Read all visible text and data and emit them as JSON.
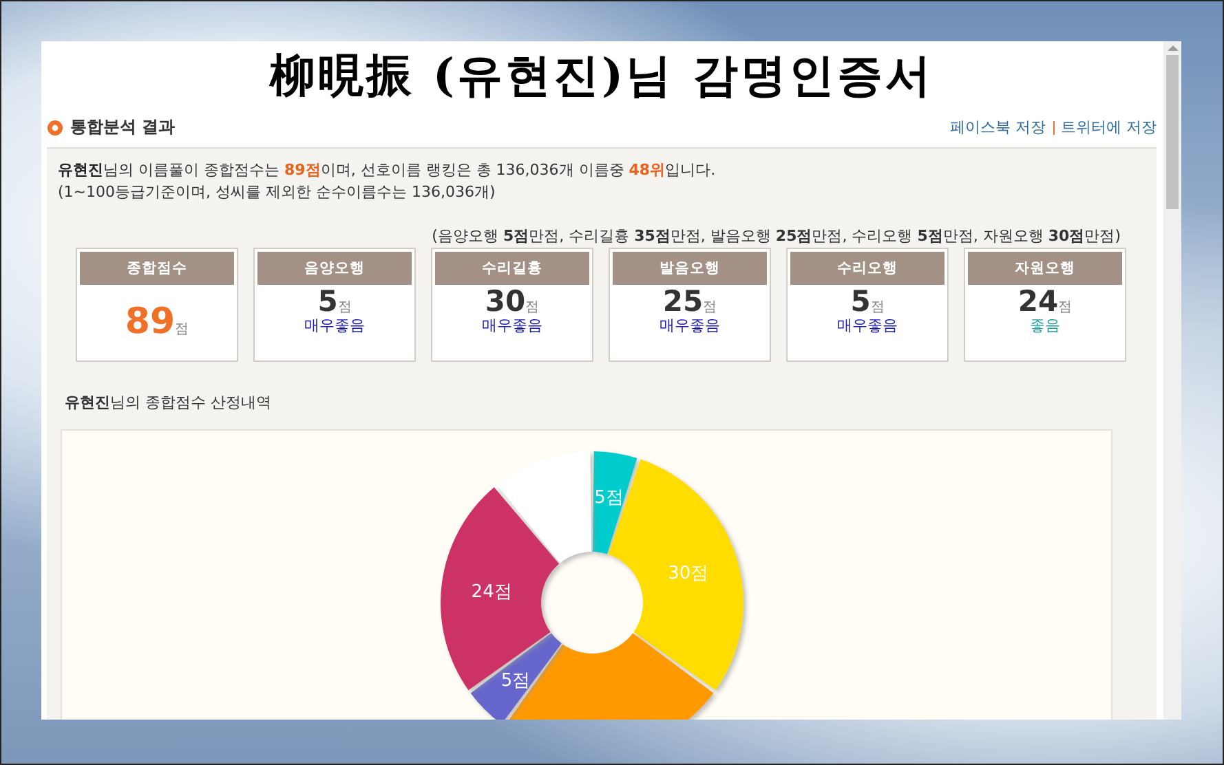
{
  "certificate_title": "柳晛振 (유현진)님 감명인증서",
  "section": {
    "title": "통합분석 결과",
    "links": [
      "페이스북 저장",
      "트위터에 저장"
    ]
  },
  "summary": {
    "lines": [
      "**유현진**님의 이름풀이 종합점수는 **89점**이며, 선호이름 랭킹은 총 136,036개 이름중 **48위**입니다.",
      "(1~100등급기준이며, 성씨를 제외한 순수이름수는 136,036개)"
    ]
  },
  "max_scores_note": "(음양오행 **5점**만점, 수리길흉 **35점**만점, 발음오행 **25점**만점, 수리오행 **5점**만점, 자원오행 **30점**만점)",
  "score_cards": [
    {
      "kind": "total",
      "label": "종합점수",
      "score": "89",
      "unit": "점"
    },
    {
      "kind": "element",
      "label": "음양오행",
      "score": "5",
      "unit": "점",
      "grade": "매우좋음",
      "color": "#1a1ab0"
    },
    {
      "kind": "element",
      "label": "수리길흉",
      "score": "30",
      "unit": "점",
      "grade": "매우좋음",
      "color": "#1a1ab0"
    },
    {
      "kind": "element",
      "label": "발음오행",
      "score": "25",
      "unit": "점",
      "grade": "매우좋음",
      "color": "#1a1ab0"
    },
    {
      "kind": "element",
      "label": "수리오행",
      "score": "5",
      "unit": "점",
      "grade": "매우좋음",
      "color": "#1a1ab0"
    },
    {
      "kind": "element",
      "label": "자원오행",
      "score": "24",
      "unit": "점",
      "grade": "좋음",
      "color": "#22a0a0"
    }
  ],
  "breakdown": {
    "heading": "**유현진**님의 종합점수 산정내역",
    "chart_data": {
      "type": "donut",
      "values": [
        5,
        30,
        25,
        5,
        24,
        11
      ],
      "colors": [
        "#00cccc",
        "#ffdd00",
        "#ff9900",
        "#6666cc",
        "#cc3366",
        "#ffffff"
      ],
      "value_labels": [
        "5점",
        "30점",
        null,
        "5점",
        "24점",
        null
      ]
    }
  }
}
